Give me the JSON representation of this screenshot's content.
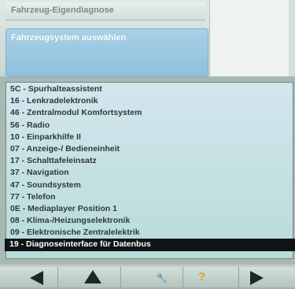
{
  "header": {
    "title": "Fahrzeug-Eigendiagnose",
    "section": "Fahrzeugsystem auswählen"
  },
  "systems": [
    "5C - Spurhalteassistent",
    "16 - Lenkradelektronik",
    "46 - Zentralmodul Komfortsystem",
    "56 - Radio",
    "10 - Einparkhilfe II",
    "07 - Anzeige-/ Bedieneinheit",
    "17 - Schalttafeleinsatz",
    "37 - Navigation",
    "47 - Soundsystem",
    "77 - Telefon",
    "0E - Mediaplayer Position 1",
    "08 - Klima-/Heizungselektronik",
    "09 - Elektronische Zentralelektrik",
    "19 - Diagnoseinterface für Datenbus"
  ],
  "selected_index": 13,
  "nav": {
    "back_icon": "triangle-left-icon",
    "up_icon": "triangle-up-icon",
    "tools_icon": "wrench-icon",
    "help_icon": "question-icon",
    "help_glyph": "?",
    "forward_icon": "triangle-right-icon"
  }
}
